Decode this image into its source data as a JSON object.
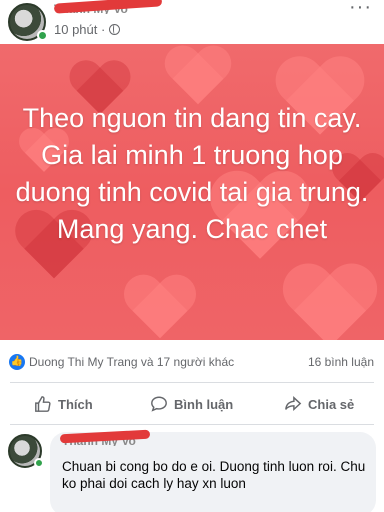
{
  "post": {
    "author": "Thanh My Vo",
    "time": "10 phút ·",
    "more": "···",
    "image_text": "Theo nguon tin dang tin cay. Gia lai minh 1 truong hop duong tinh covid tai gia trung. Mang yang. Chac chet",
    "reactions_text": "Duong Thi My Trang và 17 người khác",
    "comments_count": "16 bình luận"
  },
  "actions": {
    "like": "Thích",
    "comment": "Bình luận",
    "share": "Chia sẻ"
  },
  "comment": {
    "author": "Thanh My Vo",
    "text": "Chuan bi cong bo do e oi. Duong tinh luon roi. Chu ko phai doi cach ly hay xn luon"
  },
  "colors": {
    "image_bg": "#ee5d60",
    "like_blue": "#1877f2",
    "online_green": "#31a24c",
    "redaction": "#e23a3a"
  },
  "icons": {
    "privacy": "globe-icon",
    "like_badge": "thumbs-up-icon",
    "like_action": "thumbs-up-outline-icon",
    "comment_action": "speech-bubble-icon",
    "share_action": "share-arrow-icon",
    "more": "more-dots-icon"
  }
}
